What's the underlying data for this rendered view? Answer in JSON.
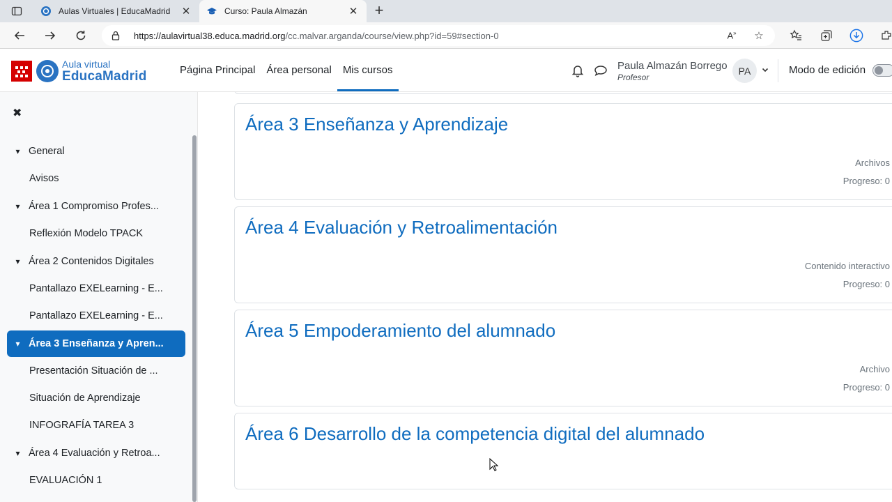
{
  "browser": {
    "tabs": [
      {
        "title": "Aulas Virtuales | EducaMadrid",
        "active": false
      },
      {
        "title": "Curso: Paula Almazán",
        "active": true
      }
    ],
    "url_host": "https://aulavirtual38.educa.madrid.org",
    "url_path": "/cc.malvar.arganda/course/view.php?id=59#section-0"
  },
  "header": {
    "logo_top": "Aula virtual",
    "logo_bottom": "EducaMadrid",
    "nav": [
      "Página Principal",
      "Área personal",
      "Mis cursos"
    ],
    "active_nav": "Mis cursos",
    "user_name": "Paula Almazán Borrego",
    "user_role": "Profesor",
    "avatar_initials": "PA",
    "edit_mode_label": "Modo de edición",
    "edit_mode_on": false
  },
  "course_index": {
    "items": [
      {
        "label": "General",
        "type": "section"
      },
      {
        "label": "Avisos",
        "type": "activity"
      },
      {
        "label": "Área 1 Compromiso Profes...",
        "type": "section"
      },
      {
        "label": "Reflexión Modelo TPACK",
        "type": "activity"
      },
      {
        "label": "Área 2 Contenidos Digitales",
        "type": "section"
      },
      {
        "label": "Pantallazo EXELearning - E...",
        "type": "activity"
      },
      {
        "label": "Pantallazo EXELearning - E...",
        "type": "activity"
      },
      {
        "label": "Área 3 Enseñanza y Apren...",
        "type": "section",
        "current": true
      },
      {
        "label": "Presentación Situación de ...",
        "type": "activity"
      },
      {
        "label": "Situación de Aprendizaje",
        "type": "activity"
      },
      {
        "label": "INFOGRAFÍA TAREA 3",
        "type": "activity"
      },
      {
        "label": "Área 4 Evaluación y Retroa...",
        "type": "section"
      },
      {
        "label": "EVALUACIÓN 1",
        "type": "activity"
      }
    ]
  },
  "sections": [
    {
      "title": "Área 3 Enseñanza y Aprendizaje",
      "meta1": "Archivos",
      "meta2": "Progreso: 0"
    },
    {
      "title": "Área 4 Evaluación y Retroalimentación",
      "meta1": "Contenido interactivo",
      "meta2": "Progreso: 0"
    },
    {
      "title": "Área 5 Empoderamiento del alumnado",
      "meta1": "Archivo",
      "meta2": "Progreso: 0"
    },
    {
      "title": "Área 6 Desarrollo de la competencia digital del alumnado",
      "meta1": "",
      "meta2": ""
    }
  ],
  "colors": {
    "primary": "#0f6cbf",
    "brand_red": "#d50000",
    "brand_blue": "#2a73c2"
  }
}
